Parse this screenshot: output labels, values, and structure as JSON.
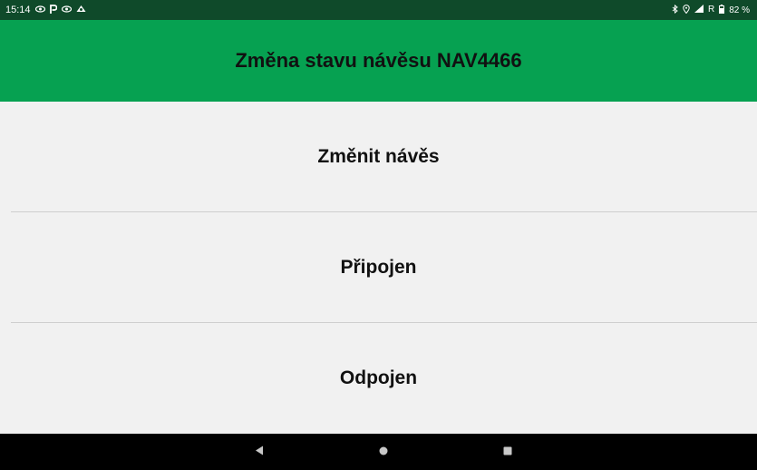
{
  "status_bar": {
    "time": "15:14",
    "left_icons": [
      "eye-icon",
      "p-icon",
      "eye-icon",
      "cloud-icon"
    ],
    "right_icons": [
      "bluetooth-icon",
      "location-icon",
      "signal-icon",
      "battery-icon"
    ],
    "roaming_label": "R",
    "battery": "82 %"
  },
  "header": {
    "title": "Změna stavu návěsu NAV4466"
  },
  "options": [
    {
      "label": "Změnit návěs"
    },
    {
      "label": "Připojen"
    },
    {
      "label": "Odpojen"
    }
  ],
  "nav": {
    "icons": [
      "back-icon",
      "home-icon",
      "recents-icon"
    ]
  },
  "colors": {
    "status_bar": "#0f4a2a",
    "app_bar": "#06a151",
    "background": "#f1f1f1",
    "nav_bar": "#000000"
  }
}
